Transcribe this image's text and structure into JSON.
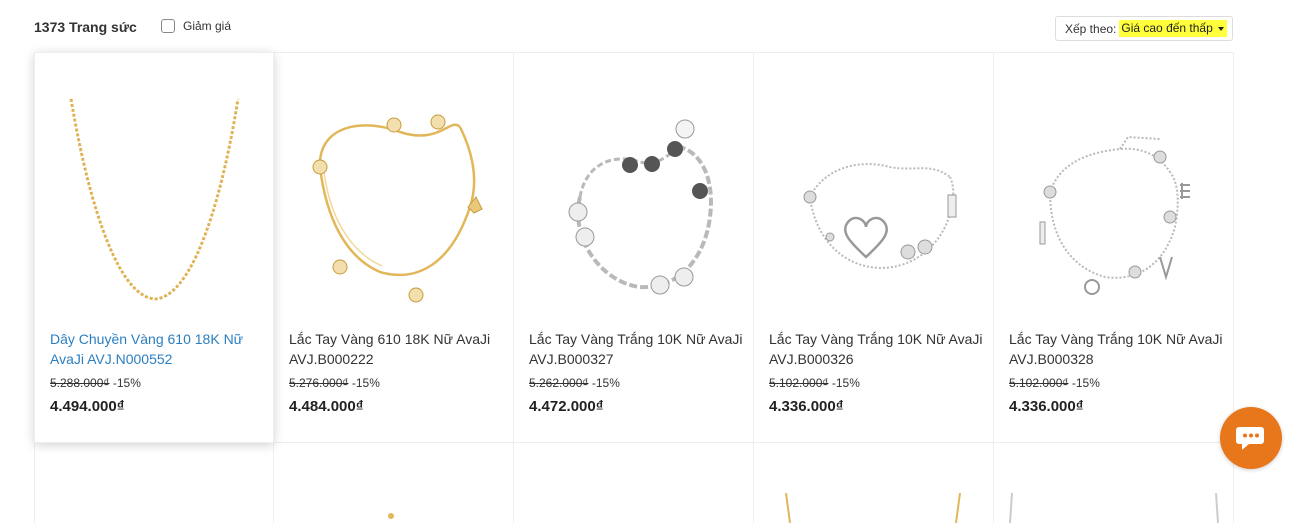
{
  "toolbar": {
    "count_label": "1373 Trang sức",
    "discount_label": "Giảm giá",
    "sort_label": "Xếp theo:",
    "sort_value": "Giá cao đến thấp"
  },
  "products": [
    {
      "name": "Dây Chuyền Vàng 610 18K Nữ AvaJi AVJ.N000552",
      "old_price": "5.288.000₫",
      "discount": "-15%",
      "price": "4.494.000₫",
      "image": "gold-necklace"
    },
    {
      "name": "Lắc Tay Vàng 610 18K Nữ AvaJi AVJ.B000222",
      "old_price": "5.276.000₫",
      "discount": "-15%",
      "price": "4.484.000₫",
      "image": "gold-charm-bracelet"
    },
    {
      "name": "Lắc Tay Vàng Trắng 10K Nữ AvaJi AVJ.B000327",
      "old_price": "5.262.000₫",
      "discount": "-15%",
      "price": "4.472.000₫",
      "image": "white-gold-link-bracelet"
    },
    {
      "name": "Lắc Tay Vàng Trắng 10K Nữ AvaJi AVJ.B000326",
      "old_price": "5.102.000₫",
      "discount": "-15%",
      "price": "4.336.000₫",
      "image": "white-gold-heart-bracelet"
    },
    {
      "name": "Lắc Tay Vàng Trắng 10K Nữ AvaJi AVJ.B000328",
      "old_price": "5.102.000₫",
      "discount": "-15%",
      "price": "4.336.000₫",
      "image": "white-gold-love-bracelet"
    }
  ],
  "chat": {
    "icon": "chat-bubble-icon",
    "color": "#e8761a"
  },
  "colors": {
    "gold": "#e2b75a",
    "silver": "#b9b9b9",
    "link": "#2b7fc1",
    "highlight": "#ffff3b"
  }
}
